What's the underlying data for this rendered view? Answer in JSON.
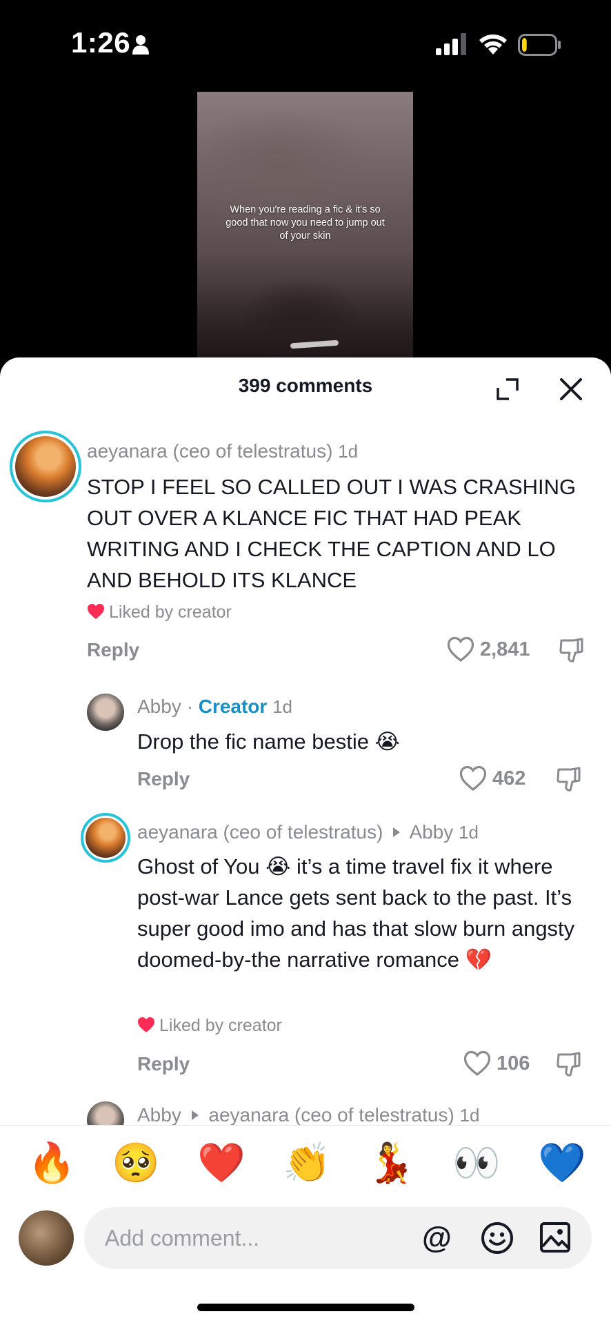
{
  "status_bar": {
    "time": "1:26",
    "battery_level": 0.15,
    "signal_bars": 3
  },
  "video": {
    "caption": "When you're reading a fic & it's so good that now you need to jump out of your skin"
  },
  "comments_sheet": {
    "title": "399 comments",
    "comments": [
      {
        "username": "aeyanara (ceo of telestratus)",
        "time": "1d",
        "text": "STOP I FEEL SO CALLED OUT I WAS CRASHING OUT OVER A KLANCE FIC THAT HAD PEAK WRITING AND I CHECK THE CAPTION AND LO AND BEHOLD ITS KLANCE",
        "liked_by_creator": "Liked by creator",
        "reply_label": "Reply",
        "likes": "2,841"
      }
    ],
    "replies": [
      {
        "username": "Abby",
        "separator": "·",
        "badge": "Creator",
        "time": "1d",
        "text": "Drop the fic name bestie 😭",
        "reply_label": "Reply",
        "likes": "462"
      },
      {
        "username": "aeyanara (ceo of telestratus)",
        "reply_to": "Abby",
        "time": "1d",
        "text": "Ghost of You 😭 it’s a time travel fix it where post-war Lance gets sent back to the past. It’s super good imo and has that slow burn angsty doomed-by-the narrative romance 💔",
        "liked_by_creator": "Liked by creator",
        "reply_label": "Reply",
        "likes": "106"
      },
      {
        "username": "Abby",
        "reply_to": "aeyanara (ceo of telestratus)",
        "time": "1d"
      }
    ]
  },
  "emoji_bar": [
    "🔥",
    "🥺",
    "❤️",
    "👏",
    "💃",
    "👀",
    "💙"
  ],
  "composer": {
    "placeholder": "Add comment..."
  },
  "colors": {
    "creator_badge": "#1a8fc6",
    "avatar_ring": "#25c4da",
    "liked_heart": "#fe2c55"
  }
}
